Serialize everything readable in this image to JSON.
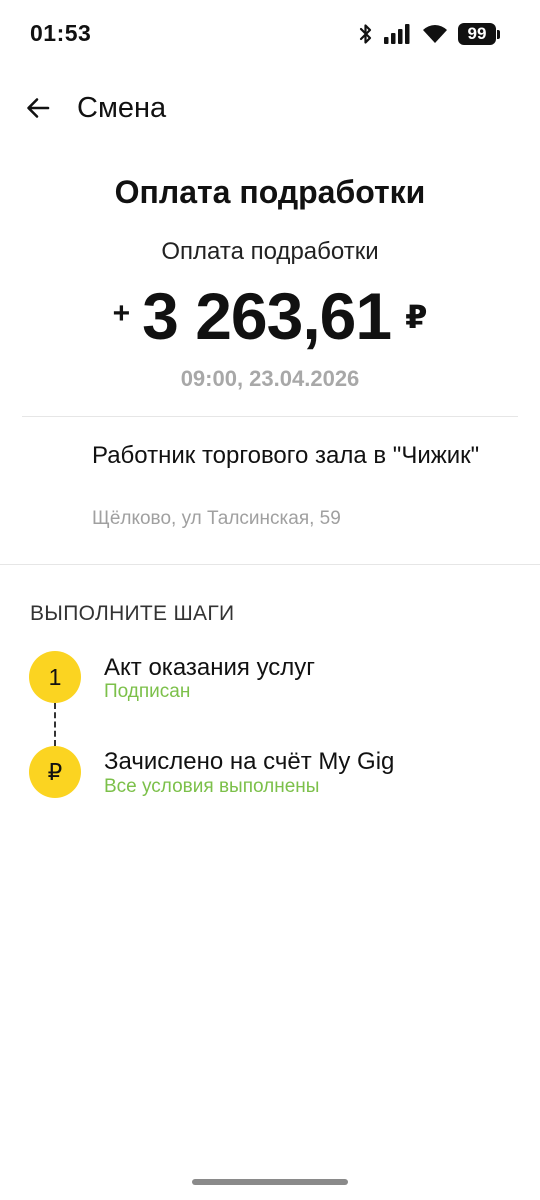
{
  "status_bar": {
    "time": "01:53",
    "battery": "99",
    "icons": [
      "bluetooth-icon",
      "signal-icon",
      "wifi-icon",
      "battery-icon"
    ]
  },
  "header": {
    "title": "Смена",
    "back_icon": "arrow-left-icon"
  },
  "payment": {
    "heading": "Оплата подработки",
    "subtitle": "Оплата подработки",
    "sign": "+",
    "amount": "3 263,61",
    "currency": "₽",
    "datetime": "09:00, 23.04.2026"
  },
  "job": {
    "title": "Работник торгового зала в \"Чижик\"",
    "address": "Щёлково, ул Талсинская, 59"
  },
  "steps": {
    "heading": "ВЫПОЛНИТЕ ШАГИ",
    "items": [
      {
        "badge": "1",
        "label": "Акт оказания услуг",
        "status": "Подписан"
      },
      {
        "badge": "₽",
        "label": "Зачислено на счёт My Gig",
        "status": "Все условия выполнены"
      }
    ]
  },
  "colors": {
    "accent_yellow": "#fbd421",
    "status_green": "#7cc04a",
    "muted_gray": "#a8a8a8"
  }
}
